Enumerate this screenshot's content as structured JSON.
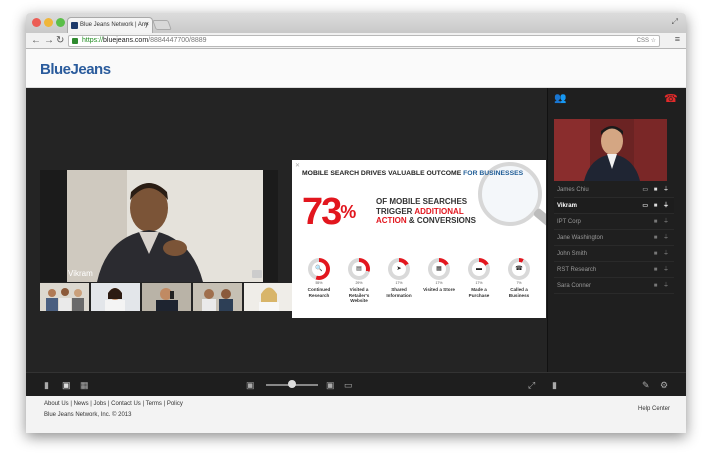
{
  "browser": {
    "tab_title": "Blue Jeans Network | Any",
    "tab_close": "×",
    "url_scheme": "https://",
    "url_host": "bluejeans.com",
    "url_path": "/8884447700/8889",
    "omni_icons": "CSS ☆"
  },
  "app": {
    "logo": "BlueJeans"
  },
  "main_video": {
    "name": "Vikram"
  },
  "slide": {
    "headline_a": "MOBILE SEARCH DRIVES VALUABLE OUTCOME ",
    "headline_b": "FOR BUSINESSES",
    "big_percent": "73",
    "percent_sign": "%",
    "line1": "OF MOBILE SEARCHES",
    "line2_prefix": "TRIGGER ",
    "line2_red": "ADDITIONAL",
    "line3_red": "ACTION",
    "line3_suffix": " & CONVERSIONS",
    "stats": [
      {
        "value": "55%",
        "label": "Continued Research",
        "fill": 0.55
      },
      {
        "value": "29%",
        "label": "Visited a Retailer's Website",
        "fill": 0.29
      },
      {
        "value": "17%",
        "label": "Shared Information",
        "fill": 0.17
      },
      {
        "value": "17%",
        "label": "Visited a Store",
        "fill": 0.17
      },
      {
        "value": "17%",
        "label": "Made a Purchase",
        "fill": 0.17
      },
      {
        "value": "7%",
        "label": "Called a Business",
        "fill": 0.07
      }
    ]
  },
  "participants": [
    {
      "name": "James Chiu",
      "icons": "▭ ■ ⏚"
    },
    {
      "name": "Vikram",
      "icons": "▭ ■ ⏚"
    },
    {
      "name": "IPT Corp",
      "icons": "■ ⏚"
    },
    {
      "name": "Jane Washington",
      "icons": "■ ⏚"
    },
    {
      "name": "John Smith",
      "icons": "■ ⏚"
    },
    {
      "name": "RST Research",
      "icons": "■ ⏚"
    },
    {
      "name": "Sara Conner",
      "icons": "■ ⏚"
    }
  ],
  "footer": {
    "about": "About Us",
    "news": "News",
    "jobs": "Jobs",
    "contact": "Contact Us",
    "terms": "Terms",
    "policy": "Policy",
    "sep": " | ",
    "copyright": "Blue Jeans Network, Inc. © 2013",
    "help": "Help Center"
  },
  "colors": {
    "accent_red": "#e2161e",
    "brand_blue": "#2a5b9c",
    "stage_bg": "#242424"
  }
}
